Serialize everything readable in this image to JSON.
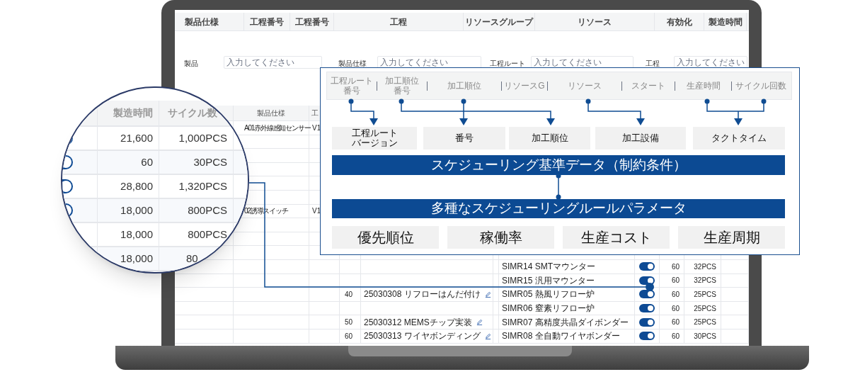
{
  "screen": {
    "columns": [
      "製品仕様",
      "工程番号",
      "工程番号",
      "工程",
      "リソースグループ",
      "リソース",
      "有効化",
      "製造時間"
    ],
    "filters": [
      {
        "label": "製品",
        "placeholder": "入力してください"
      },
      {
        "label": "製品仕様",
        "placeholder": "入力してください"
      },
      {
        "label": "工程ルート",
        "placeholder": "入力してください"
      },
      {
        "label": "工程",
        "placeholder": "入力してください"
      }
    ],
    "table": {
      "columns": [
        "製品仕様",
        "工"
      ],
      "rows": [
        {
          "spec": "A01赤外線感知センサー",
          "version": "V1"
        },
        {},
        {},
        {},
        {},
        {},
        {
          "spec": "02誘導スイッチ",
          "version": "V1"
        },
        {},
        {},
        {},
        {
          "resource": "SIMR14 SMTマウンター",
          "enabled": true,
          "time": "60",
          "qty": "32PCS"
        },
        {
          "resource": "SIMR15 汎用マウンター",
          "enabled": true,
          "time": "60",
          "qty": "32PCS"
        },
        {
          "step": "40",
          "process": "25030308 リフローはんだ付け",
          "editable": true,
          "resource": "SIMR05 熱風リフロー炉",
          "enabled": true,
          "time": "60",
          "qty": "25PCS"
        },
        {
          "resource": "SIMR06 窒素リフロー炉",
          "enabled": true,
          "time": "60",
          "qty": "25PCS"
        },
        {
          "step": "50",
          "process": "25030312 MEMSチップ実装",
          "editable": true,
          "resource": "SIMR07 高精度共晶ダイボンダー",
          "enabled": true,
          "time": "60",
          "qty": "25PCS"
        },
        {
          "step": "60",
          "process": "25030313 ワイヤボンディング",
          "editable": true,
          "resource": "SIMR08 全自動ワイヤボンダー",
          "enabled": true,
          "time": "60",
          "qty": "30PCS"
        }
      ]
    }
  },
  "magnifier": {
    "columns": [
      "製造時間",
      "サイクル数"
    ],
    "rows": [
      {
        "enabled": true,
        "time": "21,600",
        "qty": "1,000PCS"
      },
      {
        "enabled": true,
        "time": "60",
        "qty": "30PCS"
      },
      {
        "enabled": true,
        "time": "28,800",
        "qty": "1,320PCS"
      },
      {
        "enabled": true,
        "time": "18,000",
        "qty": "800PCS"
      },
      {
        "time": "18,000",
        "qty": "800PCS"
      },
      {
        "kind": "cut",
        "time": "18,000",
        "qty": "80"
      }
    ]
  },
  "diagram": {
    "fields": [
      "工程ルート番号",
      "加工順位番号",
      "加工順位",
      "リソースG",
      "リソース",
      "スタート",
      "生産時間",
      "サイクル回数"
    ],
    "targets": [
      "工程ルートバージョン",
      "番号",
      "加工順位",
      "加工設備",
      "タクトタイム"
    ],
    "base_bar": "スケジューリング基準データ（制約条件）",
    "rule_bar": "多種なスケジューリングルールパラメータ",
    "parameters": [
      "優先順位",
      "稼働率",
      "生産コスト",
      "生産周期"
    ]
  }
}
